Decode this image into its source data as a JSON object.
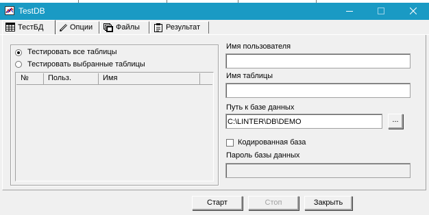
{
  "window": {
    "title": "TestDB",
    "icons": {
      "app": "chart-app-icon",
      "minimize": "minimize-icon",
      "maximize": "maximize-icon",
      "close": "close-icon"
    }
  },
  "tabs": [
    {
      "label": "ТестБД",
      "icon": "table-icon",
      "active": true
    },
    {
      "label": "Опции",
      "icon": "pencil-icon",
      "active": false
    },
    {
      "label": "Файлы",
      "icon": "files-icon",
      "active": false
    },
    {
      "label": "Результат",
      "icon": "report-icon",
      "active": false
    }
  ],
  "left": {
    "radio_all": {
      "label": "Тестировать все таблицы",
      "checked": true
    },
    "radio_selected": {
      "label": "Тестировать выбранные таблицы",
      "checked": false
    },
    "table_columns": [
      "№",
      "Польз.",
      "Имя"
    ],
    "rows": []
  },
  "right": {
    "user_label": "Имя пользователя",
    "user_value": "",
    "table_label": "Имя таблицы",
    "table_value": "",
    "path_label": "Путь к базе данных",
    "path_value": "C:\\LINTER\\DB\\DEMO",
    "browse_label": "...",
    "encoded_label": "Кодированная база",
    "encoded_checked": false,
    "password_label": "Пароль базы данных",
    "password_value": ""
  },
  "footer": {
    "start": "Старт",
    "stop": "Стоп",
    "close": "Закрыть"
  }
}
